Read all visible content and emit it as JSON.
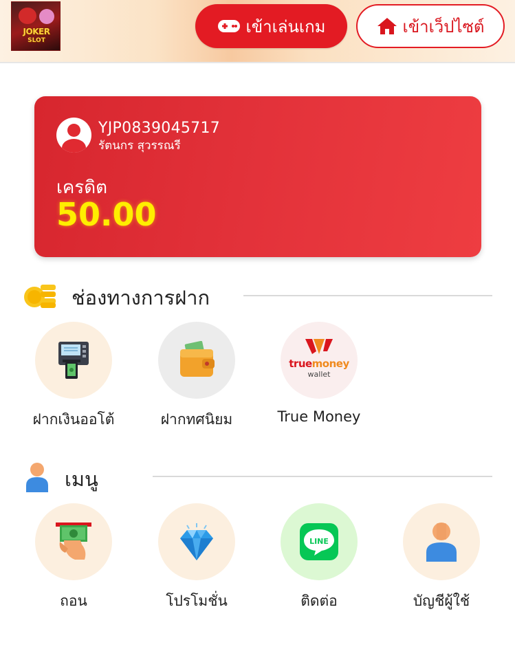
{
  "header": {
    "logo_text": "JOKER",
    "logo_sub": "SLOT",
    "play_button_label": "เข้าเล่นเกม",
    "site_button_label": "เข้าเว็ปไซต์"
  },
  "account": {
    "username": "YJP0839045717",
    "full_name": "รัตนกร สุวรรณรี",
    "credit_label": "เครดิต",
    "credit_value": "50.00"
  },
  "deposit_section": {
    "title": "ช่องทางการฝาก",
    "items": [
      {
        "label": "ฝากเงินออโต้",
        "icon": "atm-icon"
      },
      {
        "label": "ฝากทศนิยม",
        "icon": "wallet-icon"
      },
      {
        "label": "True Money",
        "icon": "truemoney-wallet-icon",
        "brand_true": "true",
        "brand_money": "money",
        "brand_wallet": "wallet"
      }
    ]
  },
  "menu_section": {
    "title": "เมนู",
    "items": [
      {
        "label": "ถอน",
        "icon": "withdraw-cash-icon"
      },
      {
        "label": "โปรโมชั่น",
        "icon": "diamond-icon"
      },
      {
        "label": "ติดต่อ",
        "icon": "line-icon",
        "icon_text": "LINE"
      },
      {
        "label": "บัญชีผู้ใช้",
        "icon": "user-account-icon"
      }
    ]
  },
  "colors": {
    "brand_red": "#e31b23",
    "credit_yellow": "#ffee00",
    "line_green": "#06c755"
  }
}
